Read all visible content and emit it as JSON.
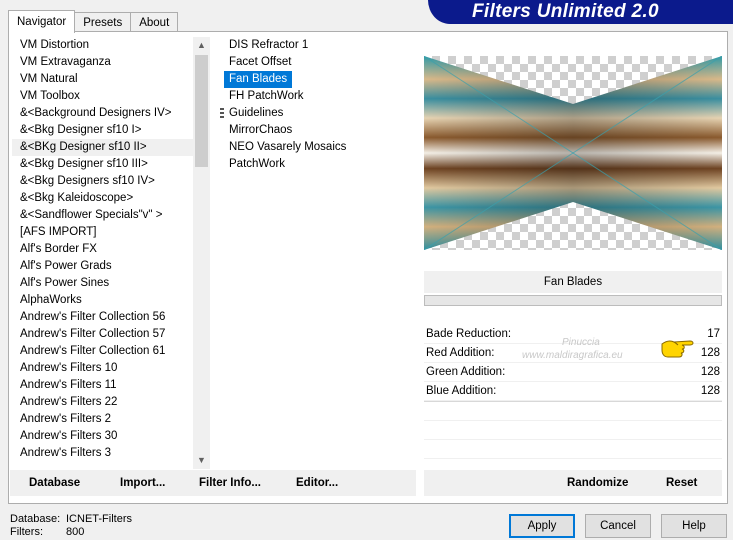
{
  "tabs": [
    "Navigator",
    "Presets",
    "About"
  ],
  "title": "Filters Unlimited 2.0",
  "categories": [
    "VM Distortion",
    "VM Extravaganza",
    "VM Natural",
    "VM Toolbox",
    "&<Background Designers IV>",
    "&<Bkg Designer sf10 I>",
    "&<BKg Designer sf10 II>",
    "&<Bkg Designer sf10 III>",
    "&<Bkg Designers sf10 IV>",
    "&<Bkg Kaleidoscope>",
    "&<Sandflower Specials\"v\" >",
    "[AFS IMPORT]",
    "Alf's Border FX",
    "Alf's Power Grads",
    "Alf's Power Sines",
    "AlphaWorks",
    "Andrew's Filter Collection 56",
    "Andrew's Filter Collection 57",
    "Andrew's Filter Collection 61",
    "Andrew's Filters 10",
    "Andrew's Filters 11",
    "Andrew's Filters 22",
    "Andrew's Filters 2",
    "Andrew's Filters 30",
    "Andrew's Filters 3"
  ],
  "filters": [
    "DIS Refractor 1",
    "Facet Offset",
    "Fan Blades",
    "FH PatchWork",
    "Guidelines",
    "MirrorChaos",
    "NEO Vasarely Mosaics",
    "PatchWork"
  ],
  "selected_filter_name": "Fan Blades",
  "controls": [
    {
      "name": "Bade Reduction:",
      "value": "17"
    },
    {
      "name": "Red Addition:",
      "value": "128"
    },
    {
      "name": "Green Addition:",
      "value": "128"
    },
    {
      "name": "Blue Addition:",
      "value": "128"
    }
  ],
  "watermark": {
    "line1": "Pinuccia",
    "line2": "www.maldiragrafica.eu"
  },
  "bottom_left_buttons": [
    "Database",
    "Import...",
    "Filter Info...",
    "Editor..."
  ],
  "bottom_right_buttons": [
    "Randomize",
    "Reset"
  ],
  "status": {
    "database_label": "Database:",
    "database_value": "ICNET-Filters",
    "filters_label": "Filters:",
    "filters_value": "800"
  },
  "dialog_buttons": {
    "apply": "Apply",
    "cancel": "Cancel",
    "help": "Help"
  },
  "colors": {
    "banner": "#0b1a8c",
    "selection": "#0078d7",
    "default_border": "#0078d7"
  }
}
